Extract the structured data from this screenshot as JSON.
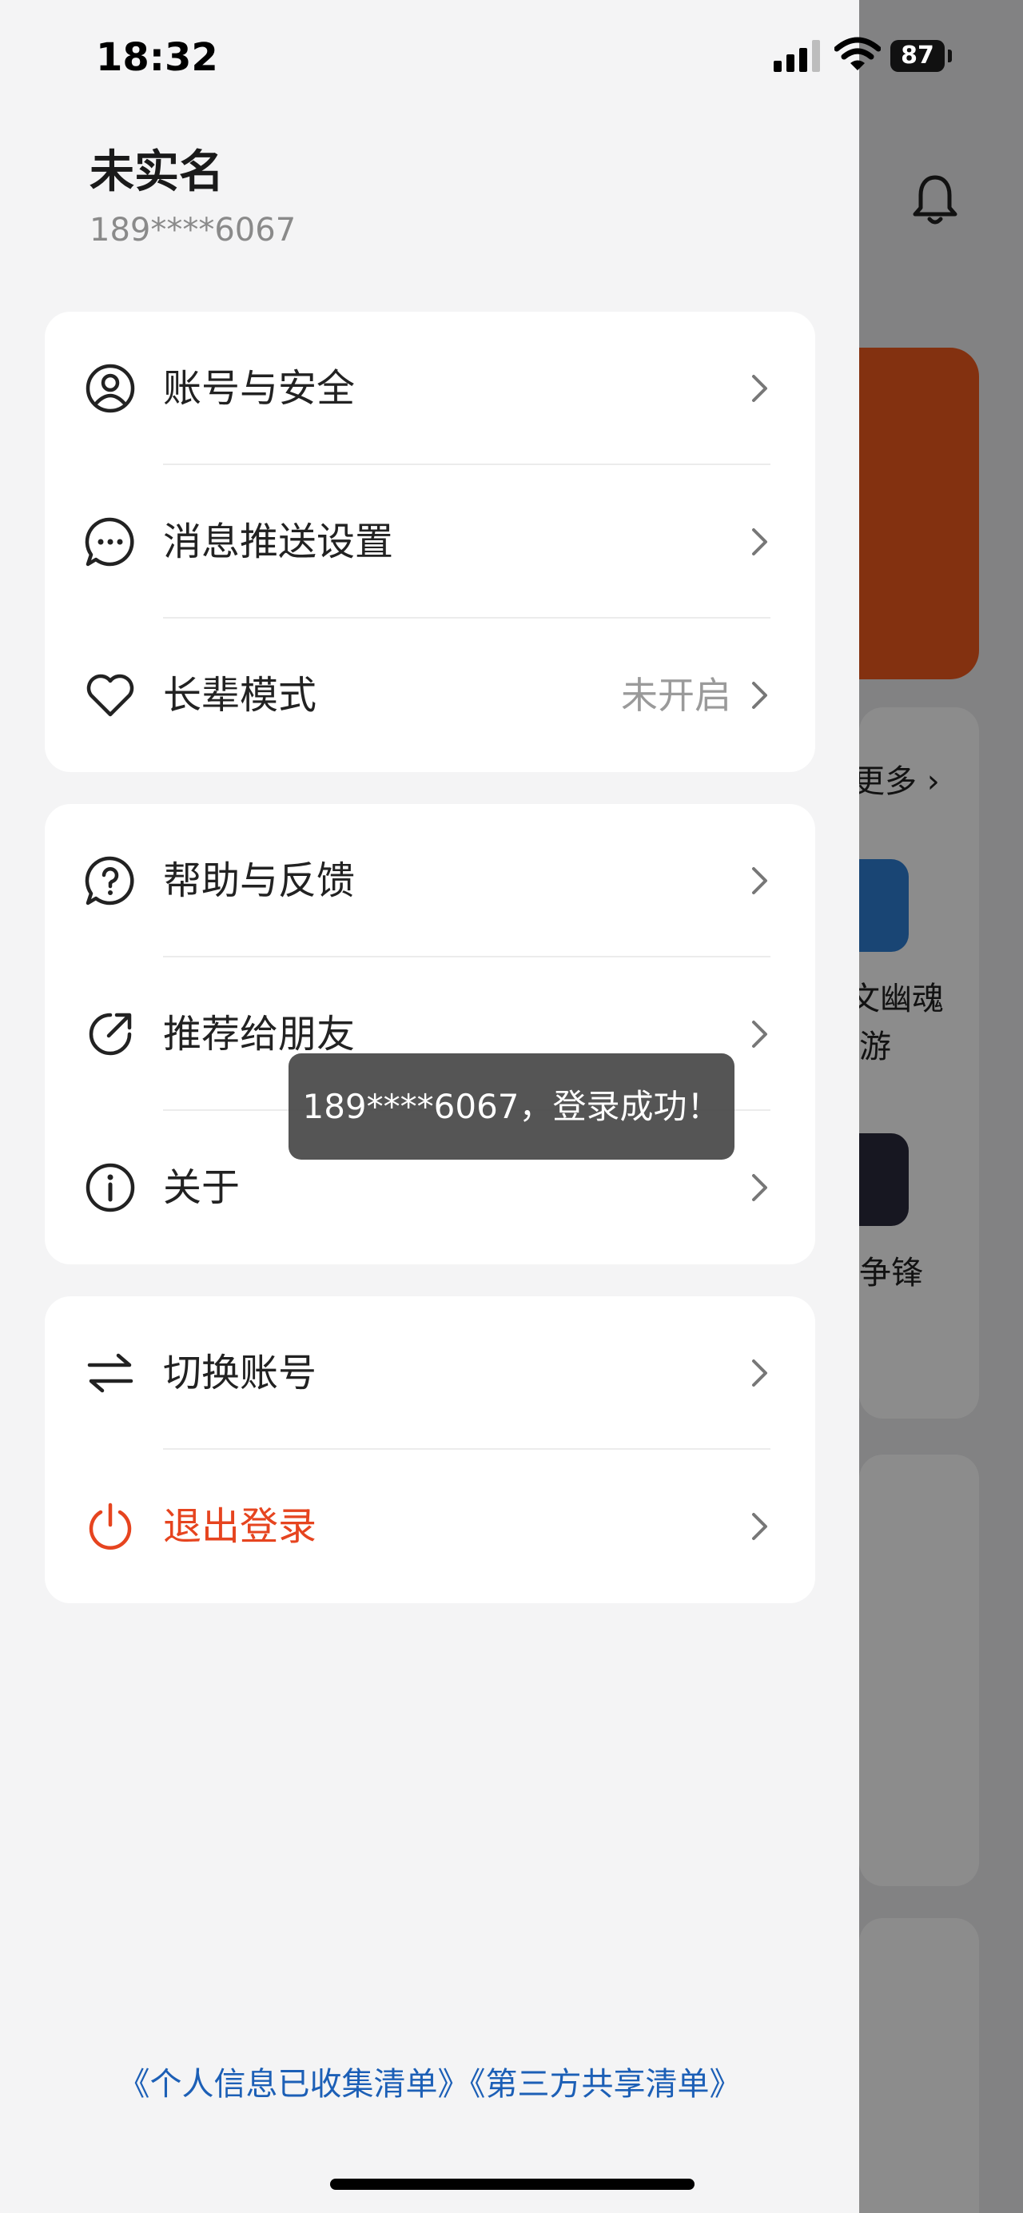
{
  "status_bar": {
    "time": "18:32",
    "battery": "87",
    "icons": [
      "signal-icon",
      "wifi-icon",
      "battery-icon"
    ]
  },
  "profile": {
    "name": "未实名",
    "phone": "189****6067"
  },
  "menu_groups": [
    {
      "items": [
        {
          "icon": "user-circle-icon",
          "label": "账号与安全",
          "value": ""
        },
        {
          "icon": "chat-bubble-icon",
          "label": "消息推送设置",
          "value": ""
        },
        {
          "icon": "heart-icon",
          "label": "长辈模式",
          "value": "未开启"
        }
      ]
    },
    {
      "items": [
        {
          "icon": "help-question-icon",
          "label": "帮助与反馈",
          "value": ""
        },
        {
          "icon": "share-arrow-icon",
          "label": "推荐给朋友",
          "value": ""
        },
        {
          "icon": "info-icon",
          "label": "关于",
          "value": ""
        }
      ]
    },
    {
      "items": [
        {
          "icon": "switch-arrows-icon",
          "label": "切换账号",
          "value": ""
        },
        {
          "icon": "power-icon",
          "label": "退出登录",
          "value": ""
        }
      ]
    }
  ],
  "toast": {
    "message": "189****6067，登录成功！"
  },
  "footer": {
    "personal_info_link": "《个人信息已收集清单》",
    "third_party_link": "《第三方共享清单》"
  },
  "background_app": {
    "more_link": "更多 ›",
    "game_1": "文幽魂",
    "game_1_sub": "游",
    "game_2": "争锋"
  },
  "colors": {
    "accent_danger": "#e6441f",
    "link": "#1c5fb6",
    "banner": "#ef5a1e"
  }
}
